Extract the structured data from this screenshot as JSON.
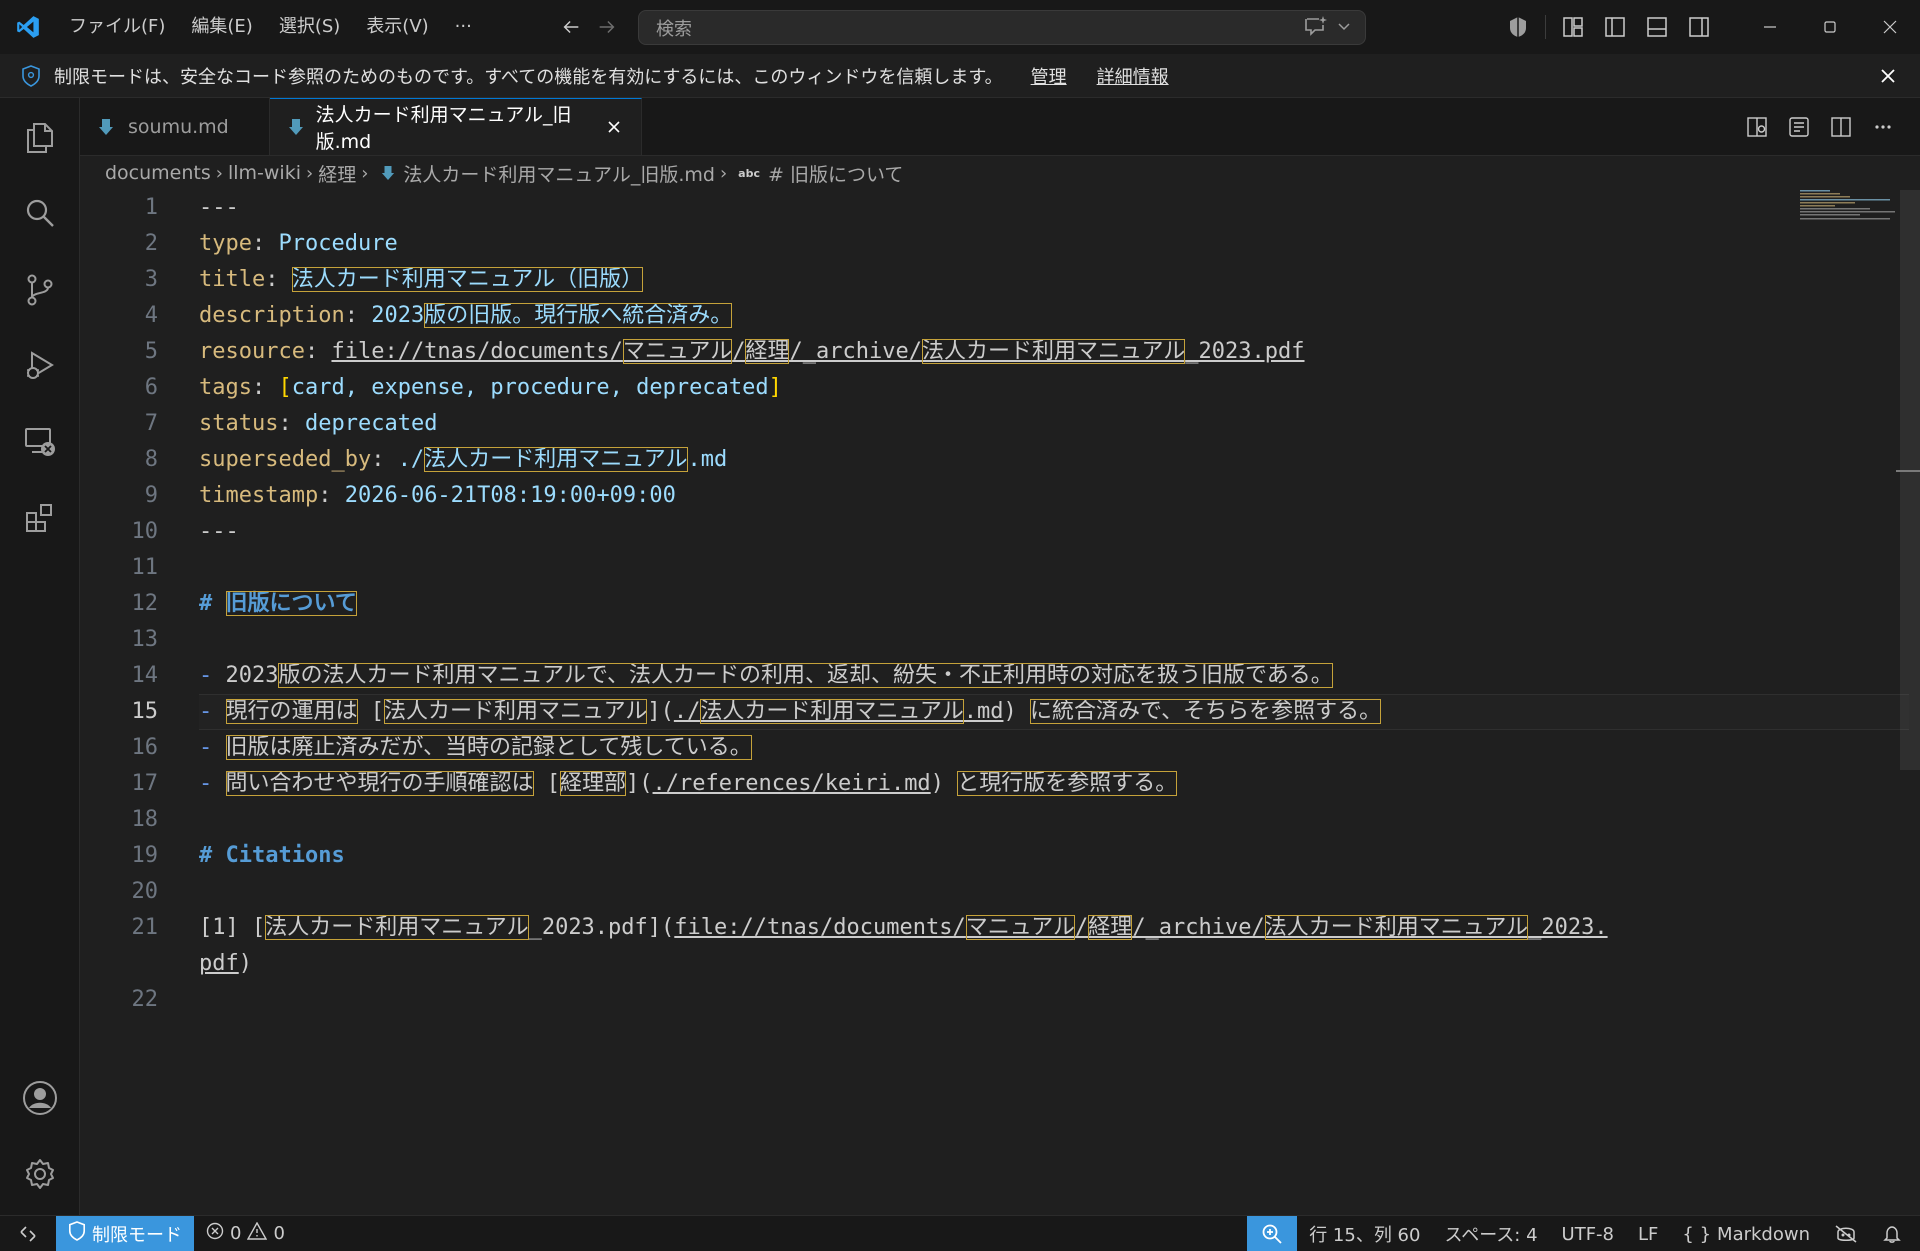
{
  "menu": [
    "ファイル(F)",
    "編集(E)",
    "選択(S)",
    "表示(V)",
    "···"
  ],
  "search": {
    "placeholder": "検索"
  },
  "banner": {
    "message": "制限モードは、安全なコード参照のためのものです。すべての機能を有効にするには、このウィンドウを信頼します。",
    "manage": "管理",
    "details": "詳細情報"
  },
  "tabs": [
    {
      "label": "soumu.md",
      "active": false
    },
    {
      "label": "法人カード利用マニュアル_旧版.md",
      "active": true
    }
  ],
  "breadcrumb": {
    "items": [
      "documents",
      "llm-wiki",
      "経理",
      "法人カード利用マニュアル_旧版.md"
    ],
    "symbol": "abc",
    "heading": "# 旧版について"
  },
  "line_numbers": [
    "1",
    "2",
    "3",
    "4",
    "5",
    "6",
    "7",
    "8",
    "9",
    "10",
    "11",
    "12",
    "13",
    "14",
    "15",
    "16",
    "17",
    "18",
    "19",
    "20",
    "21",
    "",
    "22"
  ],
  "code": {
    "l1": "---",
    "l2k": "type",
    "l2v": "Procedure",
    "l3k": "title",
    "l3v": "法人カード利用マニュアル（旧版）",
    "l4k": "description",
    "l4a": "2023",
    "l4b": "版の旧版。現行版へ統合済み。",
    "l5k": "resource",
    "l5a": "file://tnas/documents/",
    "l5b": "マニュアル",
    "l5c": "/",
    "l5d": "経理",
    "l5e": "/_archive/",
    "l5f": "法人カード利用マニュアル",
    "l5g": "_2023.pdf",
    "l6k": "tags",
    "l6v": "card, expense, procedure, deprecated",
    "l7k": "status",
    "l7v": "deprecated",
    "l8k": "superseded_by",
    "l8a": "./",
    "l8b": "法人カード利用マニュアル",
    "l8c": ".md",
    "l9k": "timestamp",
    "l9v": "2026-06-21T08:19:00+09:00",
    "l10": "---",
    "l12h": "#",
    "l12t": "旧版について",
    "l14a": "2023",
    "l14b": "版の法人カード利用マニュアルで、法人カードの利用、返却、紛失・不正利用時の対応を扱う旧版である。",
    "l15a": "現行の運用は",
    "l15b": "法人カード利用マニュアル",
    "l15c": "./",
    "l15d": "法人カード利用マニュアル",
    "l15e": ".md",
    "l15f": "に統合済みで、そちらを参照する。",
    "l16a": "旧版は廃止済みだが、当時の記録として残している。",
    "l17a": "問い合わせや現行の手順確認は",
    "l17b": "経理部",
    "l17c": "./references/keiri.md",
    "l17d": "と現行版を参照する。",
    "l19": "# Citations",
    "l21a": "[1] [",
    "l21b": "法人カード利用マニュアル",
    "l21c": "_2023.pdf",
    "l21d": "file://tnas/documents/",
    "l21e": "マニュアル",
    "l21f": "/",
    "l21g": "経理",
    "l21h": "/_archive/",
    "l21i": "法人カード利用マニュアル",
    "l21j": "_2023.",
    "l21k": "pdf"
  },
  "status": {
    "restricted": "制限モード",
    "errors": "0",
    "warnings": "0",
    "position": "行 15、列 60",
    "spaces": "スペース: 4",
    "encoding": "UTF-8",
    "eol": "LF",
    "language": "Markdown"
  },
  "colors": {
    "accent": "#0078d4",
    "status_accent": "#3a96dd",
    "markdown_icon": "#519aba"
  }
}
